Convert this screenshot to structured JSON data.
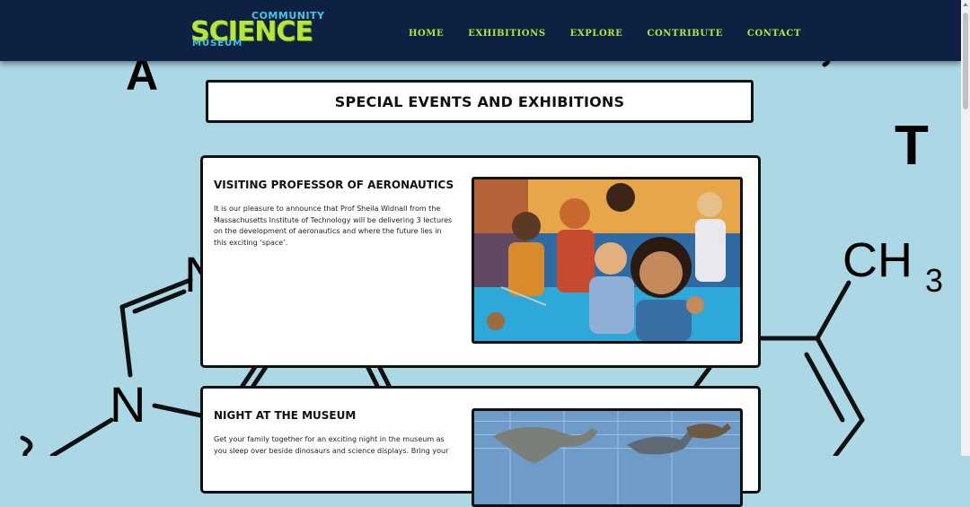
{
  "logo": {
    "word_community": "COMMUNITY",
    "word_science": "SCIENCE",
    "word_museum": "MUSEUM"
  },
  "nav": {
    "items": [
      "HOME",
      "EXHIBITIONS",
      "EXPLORE",
      "CONTRIBUTE",
      "CONTACT"
    ]
  },
  "background": {
    "letter_a": "A",
    "letter_t": "T",
    "label_ch": "CH",
    "label_3": "3",
    "label_n": "N",
    "label_n2": "N"
  },
  "page": {
    "title": "SPECIAL EVENTS AND EXHIBITIONS"
  },
  "events": [
    {
      "title": "VISITING PROFESSOR OF AERONAUTICS",
      "description": "It is our pleasure to announce that Prof Sheila Widnall from the Massachusetts Institute of Technology will be delivering 3 lectures on the development of aeronautics and where the future lies in this exciting ‘space’."
    },
    {
      "title": "NIGHT AT THE MUSEUM",
      "description": "Get your family together for an exciting night in the museum as you sleep over beside dinosaurs and science displays. Bring your"
    }
  ],
  "colors": {
    "background": "#acd8e6",
    "header": "#0e2143",
    "nav_text": "#b6e637",
    "logo_blue": "#3fc6e9"
  }
}
